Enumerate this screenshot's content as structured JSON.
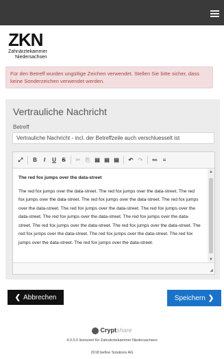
{
  "header": {
    "menu_icon": "hamburger-icon"
  },
  "logo": {
    "main": "ZKN",
    "line1": "Zahnärztekammer",
    "line2": "Niedersachsen"
  },
  "alert": {
    "text": "Für den Betreff wurden ungültige Zeichen verwendet. Stellen Sie bitte sicher, dass keine Sonderzeichen verwendet werden."
  },
  "form": {
    "title": "Vertrauliche Nachricht",
    "subject_label": "Betreff",
    "subject_value": "Vertrauliche Nachricht - incl. der Betreffzeile auch verschluesselt ist"
  },
  "editor": {
    "toolbar": [
      {
        "name": "maximize-icon",
        "glyph": "⤢"
      },
      {
        "name": "bold-button",
        "glyph": "B"
      },
      {
        "name": "italic-button",
        "glyph": "I"
      },
      {
        "name": "underline-button",
        "glyph": "U"
      },
      {
        "name": "strikethrough-button",
        "glyph": "S"
      },
      {
        "name": "cut-button",
        "glyph": "✂"
      },
      {
        "name": "copy-button",
        "glyph": "⎘"
      },
      {
        "name": "paste-button",
        "glyph": "▤"
      },
      {
        "name": "paste-text-button",
        "glyph": "▤"
      },
      {
        "name": "paste-word-button",
        "glyph": "▤"
      },
      {
        "name": "undo-button",
        "glyph": "↶"
      },
      {
        "name": "redo-button",
        "glyph": "↷"
      },
      {
        "name": "numbered-list-button",
        "glyph": "≔"
      },
      {
        "name": "bullet-list-button",
        "glyph": "≡"
      }
    ],
    "heading": "The red fox jumps over the data-street",
    "body": "The red fox jumps over the data-street. The red fox jumps over the data-street. The red fox jumps over the data-street. The red fox jumps over the data-street. The red fox jumps over the data-street. The red fox jumps over the data-street. The red fox jumps over the data-street. The red fox jumps over the data-street. The red fox jumps over the data-street. The red fox jumps over the data-street. The red fox jumps over the data-street. The red fox jumps over the data-street. The red fox jumps over the data-street. The red fox jumps over the data-street. The red fox jumps over the data-street."
  },
  "buttons": {
    "cancel": "Abbrechen",
    "save": "Speichern"
  },
  "footer": {
    "brand": "Crypt",
    "brand_suffix": "share",
    "license": "4.0.0.0 lizenziert für Zahnärztekammer Niedersachsen",
    "copyright": "2018 befine Solutions AG"
  },
  "colors": {
    "topbar": "#3a3a3a",
    "alert_bg": "#f2dede",
    "alert_text": "#a94442",
    "primary": "#1a73c8",
    "cancel": "#111111"
  }
}
